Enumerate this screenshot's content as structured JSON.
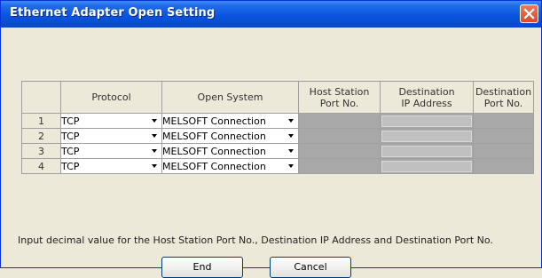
{
  "window": {
    "title": "Ethernet Adapter  Open Setting"
  },
  "table": {
    "headers": {
      "rownum": "",
      "protocol": "Protocol",
      "open_system": "Open System",
      "host_port": "Host Station\nPort No.",
      "dest_ip": "Destination\nIP Address",
      "dest_port": "Destination\nPort No."
    },
    "rows": [
      {
        "num": "1",
        "protocol": "TCP",
        "open_system": "MELSOFT Connection"
      },
      {
        "num": "2",
        "protocol": "TCP",
        "open_system": "MELSOFT Connection"
      },
      {
        "num": "3",
        "protocol": "TCP",
        "open_system": "MELSOFT Connection"
      },
      {
        "num": "4",
        "protocol": "TCP",
        "open_system": "MELSOFT Connection"
      }
    ]
  },
  "note": "Input decimal value for the Host Station Port No., Destination IP Address and Destination Port No.",
  "buttons": {
    "end": "End",
    "cancel": "Cancel"
  },
  "icons": {
    "close": "close-icon",
    "dropdown": "chevron-down-icon"
  }
}
